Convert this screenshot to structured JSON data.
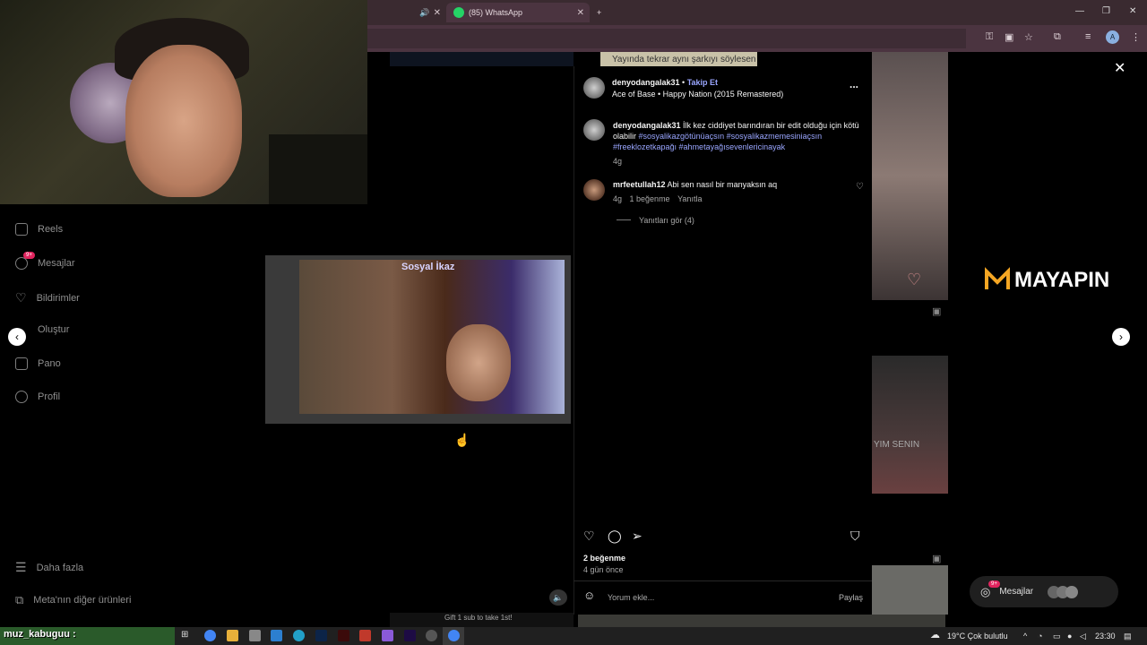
{
  "browser": {
    "tabs": [
      {
        "label": ""
      },
      {
        "label": "(85) WhatsApp"
      }
    ],
    "new_tab": "+",
    "profile_letter": "A"
  },
  "sidebar": {
    "items": [
      {
        "label": "Reels",
        "icon": "reels-icon"
      },
      {
        "label": "Mesajlar",
        "icon": "messenger-icon",
        "badge": "9+"
      },
      {
        "label": "Bildirimler",
        "icon": "heart-icon"
      },
      {
        "label": "Oluştur",
        "icon": "plus-icon"
      },
      {
        "label": "Pano",
        "icon": "dashboard-icon"
      },
      {
        "label": "Profil",
        "icon": "profile-icon"
      }
    ],
    "more_label": "Daha fazla",
    "meta_label": "Meta'nın diğer ürünleri"
  },
  "background": {
    "top_banner": "Yayında tekrar aynı şarkıyı söylesen",
    "video_title": "Sosyal İkaz",
    "bottom_text": "Gift 1 sub to take 1st!",
    "side_text": "YIM SENIN"
  },
  "post": {
    "author": "denyodangalak31",
    "follow": "Takip Et",
    "separator": "•",
    "music": "Ace of Base • Happy Nation (2015 Remastered)",
    "more": "...",
    "caption": {
      "author": "denyodangalak31",
      "text": "İlk kez ciddiyet barındıran bir edit olduğu için kötü olabilir",
      "hashtags": "#sosyalikazgötünüaçsın #sosyalikazmemesiniaçsın #freeklozetkapağı #ahmetayağısevenlericinayak",
      "time": "4g"
    },
    "comments": [
      {
        "author": "mrfeetullah12",
        "text": "Abi sen nasıl bir manyaksın aq",
        "time": "4g",
        "likes": "1 beğenme",
        "reply": "Yanıtla",
        "view_replies": "Yanıtları gör (4)"
      }
    ],
    "likes": "2 beğenme",
    "date": "4 gün önce",
    "comment_placeholder": "Yorum ekle...",
    "share": "Paylaş"
  },
  "right": {
    "logo": "MAYAPIN",
    "messages_label": "Mesajlar",
    "messages_badge": "9+"
  },
  "stream": {
    "overlay_name": "muz_kabuguu :"
  },
  "taskbar": {
    "weather": "19°C  Çok bulutlu",
    "time": "23:30"
  }
}
